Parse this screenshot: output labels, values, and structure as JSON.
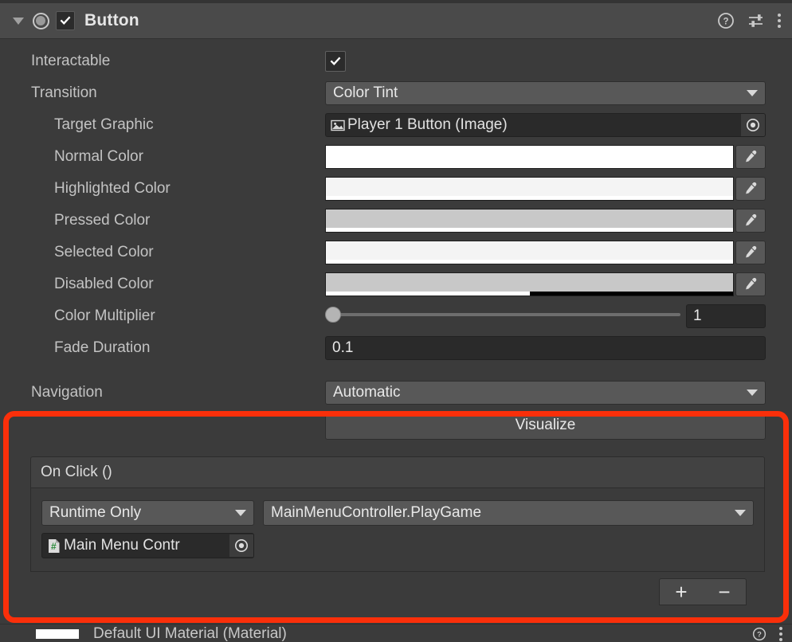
{
  "header": {
    "title": "Button",
    "enabled_checkbox": true,
    "foldout_expanded": true,
    "icons": {
      "component": "button-component-icon",
      "help": "help-icon",
      "preset": "preset-sliders-icon",
      "menu": "kebab-menu-icon"
    }
  },
  "properties": {
    "interactable": {
      "label": "Interactable",
      "checked": true
    },
    "transition": {
      "label": "Transition",
      "value": "Color Tint"
    },
    "target_graphic": {
      "label": "Target Graphic",
      "value": "Player 1 Button (Image)",
      "icon": "image-asset-icon"
    },
    "normal_color": {
      "label": "Normal Color",
      "color": "#ffffff",
      "alpha_pct": 100
    },
    "highlighted_color": {
      "label": "Highlighted Color",
      "color": "#f4f4f4",
      "alpha_pct": 100
    },
    "pressed_color": {
      "label": "Pressed Color",
      "color": "#c8c8c8",
      "alpha_pct": 100
    },
    "selected_color": {
      "label": "Selected Color",
      "color": "#f4f4f4",
      "alpha_pct": 100
    },
    "disabled_color": {
      "label": "Disabled Color",
      "color": "#c8c8c8",
      "alpha_pct": 50
    },
    "color_multiplier": {
      "label": "Color Multiplier",
      "value": "1",
      "slider_pct": 0
    },
    "fade_duration": {
      "label": "Fade Duration",
      "value": "0.1"
    },
    "navigation": {
      "label": "Navigation",
      "value": "Automatic"
    },
    "visualize_button": {
      "label": "Visualize"
    }
  },
  "on_click": {
    "title": "On Click ()",
    "entries": [
      {
        "mode": "Runtime Only",
        "function": "MainMenuController.PlayGame",
        "object": "Main Menu Contr",
        "object_icon": "script-asset-icon"
      }
    ],
    "add_label": "+",
    "remove_label": "−"
  },
  "bottom_partial": {
    "material": "Default UI Material (Material)"
  },
  "colors": {
    "panel_bg": "#3b3b3b",
    "header_bg": "#4a4a4a",
    "control_bg": "#585858",
    "input_bg": "#2a2a2a",
    "text": "#c3c3c3",
    "highlight_red": "#fa2f0a"
  }
}
